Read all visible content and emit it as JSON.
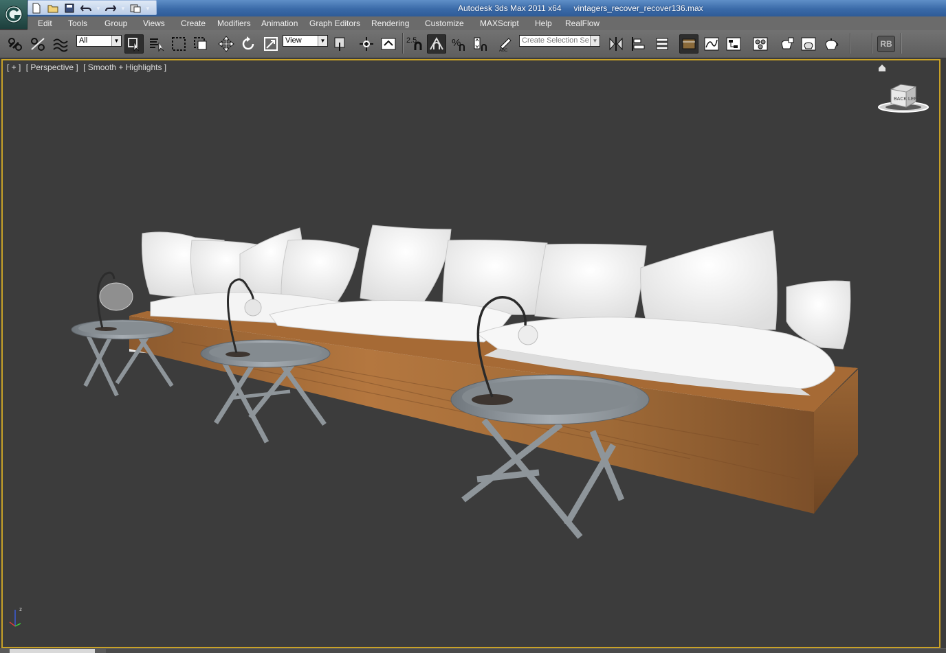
{
  "titlebar": {
    "app_title": "Autodesk 3ds Max  2011 x64",
    "file_name": "vintagers_recover_recover136.max",
    "quick_access": [
      "new-file-icon",
      "open-file-icon",
      "save-icon",
      "undo-icon",
      "redo-icon",
      "project-folder-icon"
    ]
  },
  "menu": {
    "items": [
      "Edit",
      "Tools",
      "Group",
      "Views",
      "Create",
      "Modifiers",
      "Animation",
      "Graph Editors",
      "Rendering",
      "Customize",
      "MAXScript",
      "Help",
      "RealFlow"
    ]
  },
  "toolbar": {
    "selection_filter": "All",
    "reference_coord": "View",
    "snap_value": "2.5",
    "named_selection_placeholder": "Create Selection Se",
    "rb_label": "RB"
  },
  "viewport": {
    "label_parts": [
      "[ + ]",
      "[ Perspective ]",
      "[ Smooth + Highlights ]"
    ],
    "viewcube_faces": [
      "BACK",
      "LEFT"
    ],
    "axis_label": "z"
  },
  "colors": {
    "title_blue": "#3a6aa8",
    "menu_gray": "#6b6b6b",
    "viewport_bg": "#3c3c3c",
    "viewport_border": "#c9a227",
    "wood": "#a66a35",
    "cushion": "#f2f2f2",
    "table_metal": "#8f969c"
  }
}
